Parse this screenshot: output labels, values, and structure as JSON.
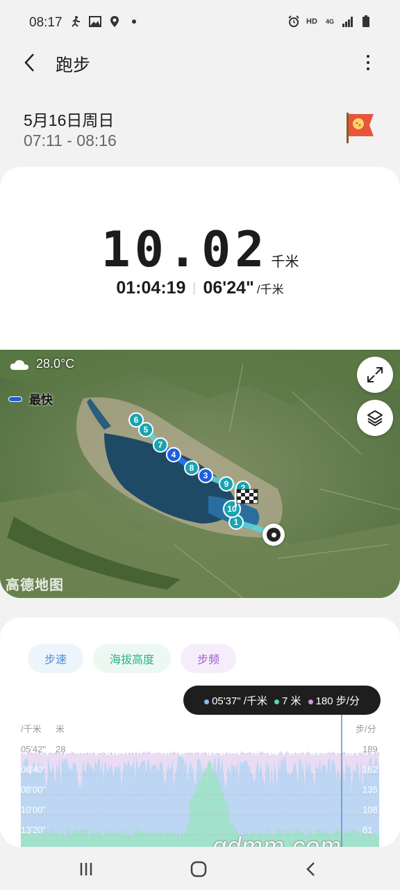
{
  "status_bar": {
    "time": "08:17",
    "left_icons": [
      "run-notification-icon",
      "gallery-icon",
      "location-icon",
      "dot-icon"
    ],
    "right_icons": [
      "alarm-icon",
      "hd-icon",
      "4g-icon",
      "signal-icon",
      "battery-icon"
    ],
    "hd_label": "HD",
    "net_label": "4G"
  },
  "appbar": {
    "title": "跑步"
  },
  "session": {
    "date": "5月16日周日",
    "time_range": "07:11 - 08:16"
  },
  "summary": {
    "distance": "10.02",
    "distance_unit": "千米",
    "duration": "01:04:19",
    "pace": "06'24\"",
    "pace_unit": "/千米"
  },
  "map": {
    "temperature": "28.0°C",
    "fastest_label": "最快",
    "provider_logo": "高德地图",
    "markers": [
      "1",
      "2",
      "3",
      "4",
      "5",
      "6",
      "7",
      "8",
      "9",
      "10"
    ],
    "colors": {
      "route": "#5fd3d8",
      "marker": "#1aa3b0",
      "fastest": "#1a5fe0"
    }
  },
  "chart": {
    "tabs": [
      "步速",
      "海拔高度",
      "步频"
    ],
    "tooltip": {
      "pace": "05'37\" /千米",
      "altitude": "7 米",
      "cadence": "180 步/分"
    },
    "left_axis_units": [
      "/千米",
      "米"
    ],
    "right_axis_unit": "步/分",
    "left_pace_ticks": [
      "05'42\"",
      "06'40\"",
      "08'00\"",
      "10'00\"",
      "13'20\""
    ],
    "left_alt_ticks": [
      "28"
    ],
    "right_ticks": [
      "189",
      "162",
      "135",
      "108",
      "81"
    ],
    "colors": {
      "pace": "#8bbcf0",
      "altitude": "#5fd6a8",
      "cadence": "#c79ae6"
    }
  },
  "watermark": "gdmm.com"
}
